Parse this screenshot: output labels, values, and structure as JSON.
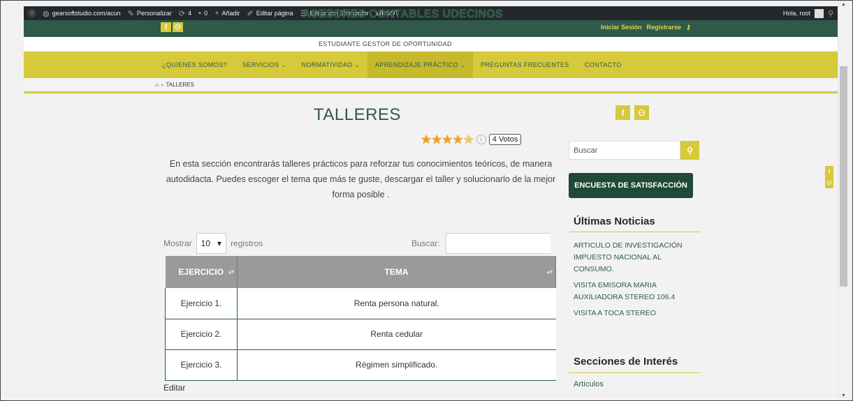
{
  "admin_bar": {
    "site_url": "gearsoftstudio.com/acun",
    "customize": "Personalizar",
    "updates_count": "4",
    "comments_count": "0",
    "add_new": "Añadir",
    "edit_page": "Editar página",
    "edit_elementor": "Editar con Elementor",
    "plugin": "WPSQT",
    "greeting": "Hola, root"
  },
  "header": {
    "site_title": "ASESORES CONTABLES UDECINOS",
    "tagline": "ESTUDIANTE GESTOR DE OPORTUNIDAD",
    "login": "Iniciar Sesión",
    "register": "Registrarse"
  },
  "nav": [
    {
      "label": "¿QUIENES SOMOS?",
      "dropdown": false
    },
    {
      "label": "SERVICIOS",
      "dropdown": true
    },
    {
      "label": "NORMATIVIDAD",
      "dropdown": true
    },
    {
      "label": "APRENDIZAJE PRÁCTICO",
      "dropdown": true
    },
    {
      "label": "PREGUNTAS FRECUENTES",
      "dropdown": false
    },
    {
      "label": "CONTACTO",
      "dropdown": false
    }
  ],
  "breadcrumb": {
    "current": "TALLERES"
  },
  "page": {
    "title": "TALLERES",
    "rating": 4.5,
    "votes_label": "4 Votos",
    "intro": "En esta sección encontrarás talleres prácticos para reforzar tus conocimientos teóricos, de manera autodidacta. Puedes escoger el tema que más te guste, descargar el taller y solucionarlo de la mejor forma posible ."
  },
  "table": {
    "show_label": "Mostrar",
    "show_value": "10",
    "records_label": "registros",
    "search_label": "Buscar:",
    "headers": [
      "EJERCICIO",
      "TEMA"
    ],
    "rows": [
      [
        "Ejercicio 1.",
        "Renta persona natural."
      ],
      [
        "Ejercicio 2.",
        "Renta cedular"
      ],
      [
        "Ejercicio 3.",
        "Régimen simplificado."
      ]
    ],
    "edit_label": "Editar"
  },
  "sidebar": {
    "search_placeholder": "Buscar",
    "survey_button": "ENCUESTA DE SATISFACCIÓN",
    "latest_news_title": "Últimas Noticias",
    "news": [
      "ARTICULO DE INVESTIGACIÓN IMPUESTO NACIONAL AL CONSUMO.",
      "VISITA EMISORA MARIA AUXILIADORA STEREO 106.4",
      "VISITA A TOCA STEREO"
    ],
    "sections_title": "Secciones de Interés",
    "sections": [
      "Artículos"
    ]
  },
  "colors": {
    "accent": "#d6c93a",
    "brand_green": "#2f5a47",
    "admin_bar": "#23282d"
  }
}
